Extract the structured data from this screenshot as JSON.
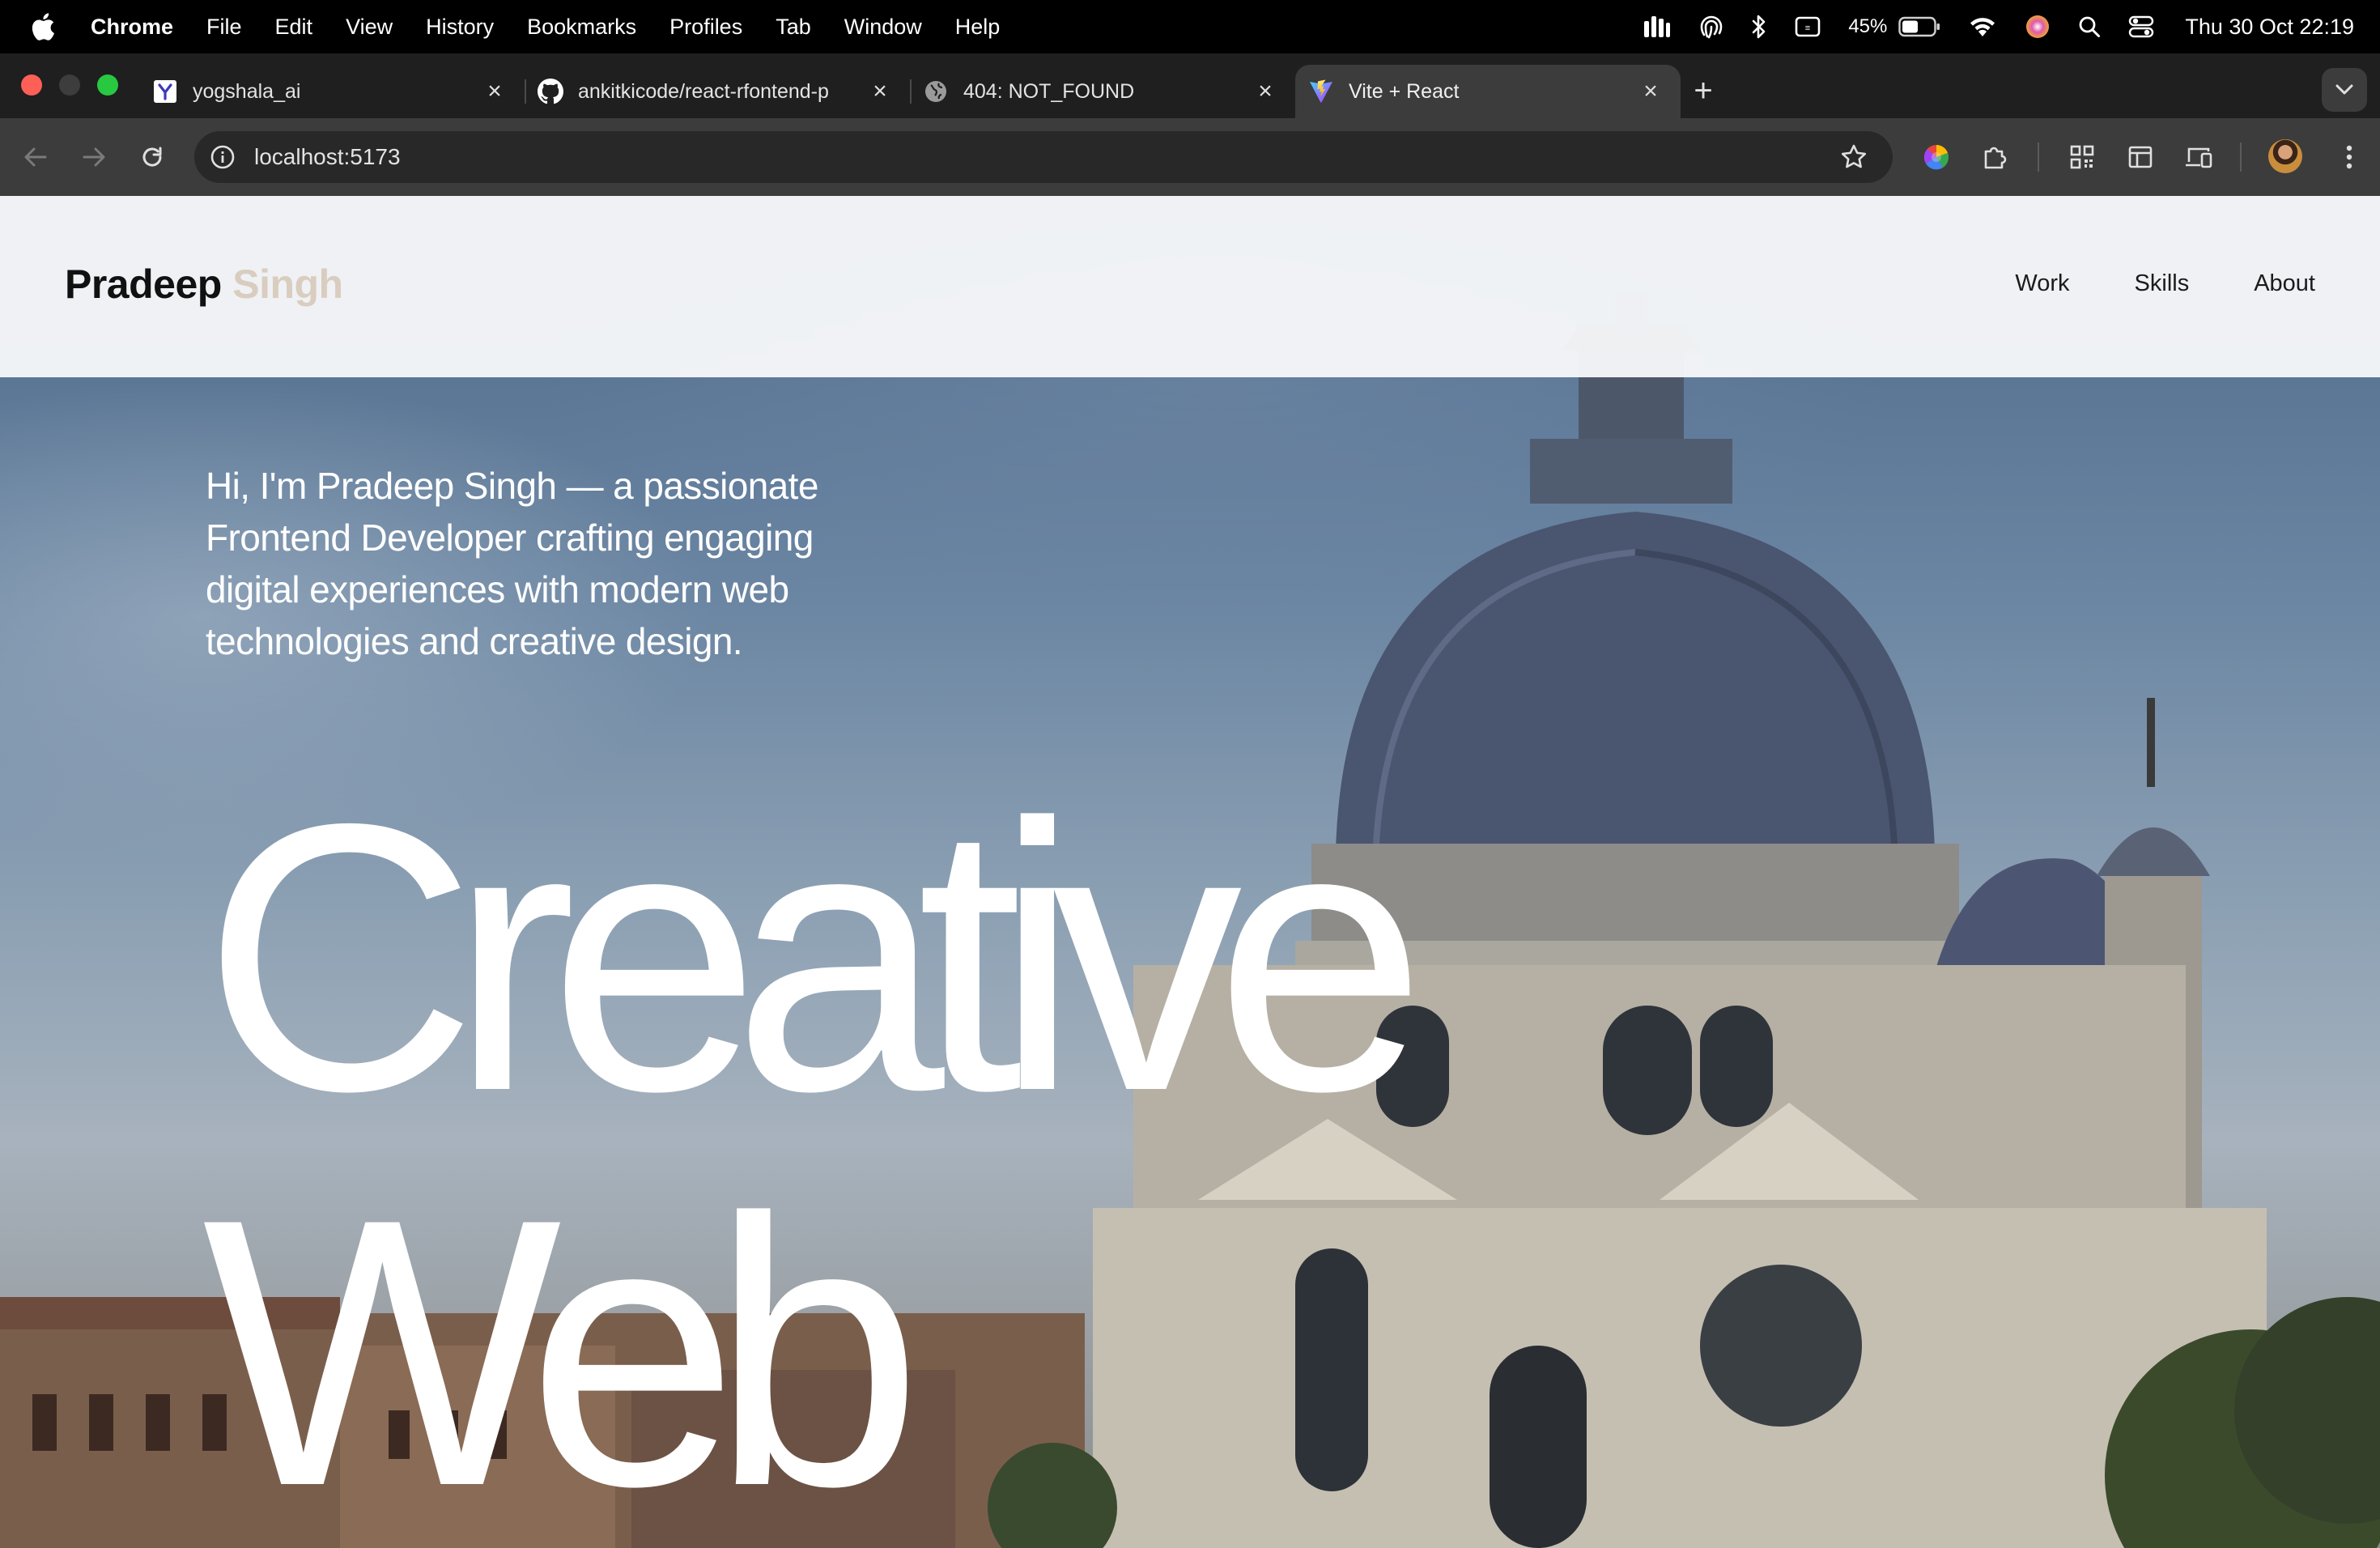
{
  "menubar": {
    "apple": "apple-logo",
    "app_name": "Chrome",
    "menus": [
      "File",
      "Edit",
      "View",
      "History",
      "Bookmarks",
      "Profiles",
      "Tab",
      "Window",
      "Help"
    ],
    "battery_percent": "45%",
    "clock": "Thu 30 Oct  22:19"
  },
  "tabs": [
    {
      "title": "yogshala_ai",
      "favicon": "yogshala-favicon"
    },
    {
      "title": "ankitkicode/react-rfontend-p",
      "favicon": "github-icon"
    },
    {
      "title": "404: NOT_FOUND",
      "favicon": "globe-icon"
    },
    {
      "title": "Vite + React",
      "favicon": "vite-icon",
      "active": true
    }
  ],
  "toolbar": {
    "url": "localhost:5173"
  },
  "site": {
    "logo_first": "Pradeep",
    "logo_last": "Singh",
    "nav": [
      "Work",
      "Skills",
      "About"
    ],
    "intro": "Hi, I'm Pradeep Singh — a passionate Frontend Developer crafting engaging digital experiences with modern web technologies and creative design.",
    "headline_line1": "Creative",
    "headline_line2": "Web"
  },
  "colors": {
    "logo_accent": "#d9cdbf",
    "menubar_bg": "#000000",
    "tabstrip_bg": "#1f1f1f",
    "toolbar_bg": "#3c3c3c"
  }
}
